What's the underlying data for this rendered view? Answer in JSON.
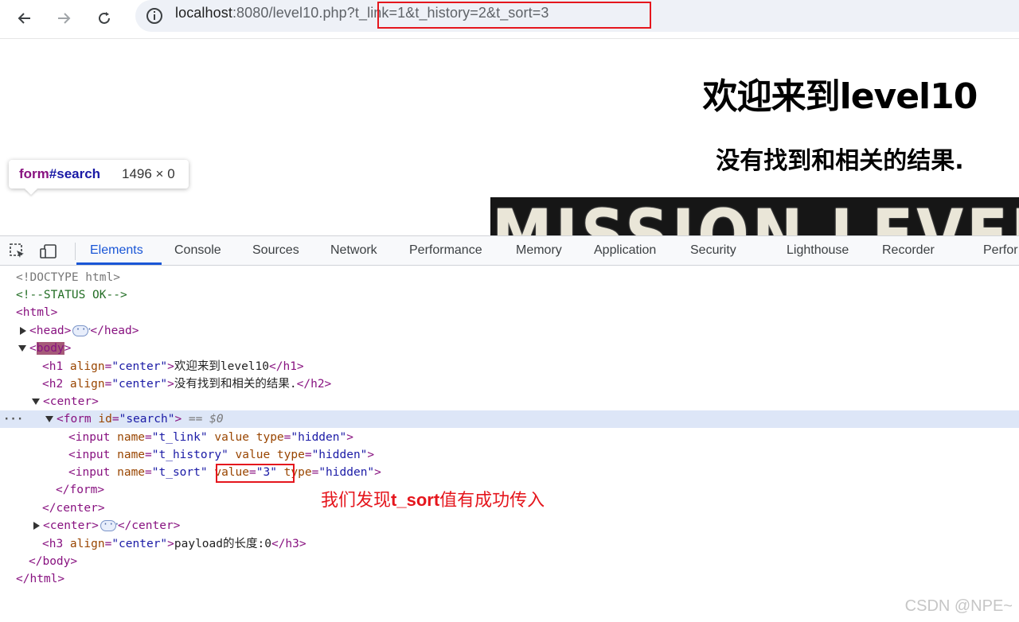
{
  "browser": {
    "url_host": "localhost",
    "url_port_path": ":8080/level10.php",
    "url_query": "?t_link=1&t_history=2&t_sort=3"
  },
  "page": {
    "h1": "欢迎来到level10",
    "h2": "没有找到和相关的结果.",
    "banner_text": "MISSION LEVEL"
  },
  "tooltip": {
    "tag": "form",
    "id": "#search",
    "size": "1496 × 0"
  },
  "devtools": {
    "tabs": [
      "Elements",
      "Console",
      "Sources",
      "Network",
      "Performance",
      "Memory",
      "Application",
      "Security",
      "Lighthouse",
      "Recorder",
      "Perfor"
    ],
    "active_tab": "Elements",
    "selected_marker": "== $0",
    "dots": "···"
  },
  "dom": {
    "doctype": "<!DOCTYPE html>",
    "comment": "<!--STATUS OK-->",
    "html_open": "<html>",
    "head_open": "<head>",
    "head_close": "</head>",
    "body_open_lt": "<",
    "body_name": "body",
    "body_open_gt": ">",
    "h1_open": "<h1 ",
    "h1_attr": "align",
    "h1_val": "\"center\"",
    "h1_text": "欢迎来到level10",
    "h1_close": "</h1>",
    "h2_open": "<h2 ",
    "h2_attr": "align",
    "h2_val": "\"center\"",
    "h2_text": "没有找到和相关的结果.",
    "h2_close": "</h2>",
    "center_open": "<center>",
    "form_open": "<form ",
    "form_attr": "id",
    "form_val": "\"search\"",
    "gt": ">",
    "inputs": [
      {
        "name": "\"t_link\"",
        "value_attr": "value",
        "value_val": "",
        "type_val": "\"hidden\""
      },
      {
        "name": "\"t_history\"",
        "value_attr": "value",
        "value_val": "",
        "type_val": "\"hidden\""
      },
      {
        "name": "\"t_sort\"",
        "value_attr": "value",
        "value_val": "\"3\"",
        "type_val": "\"hidden\""
      }
    ],
    "input_open": "<input ",
    "name_attr": "name",
    "type_attr": "type",
    "eq": "=",
    "form_close": "</form>",
    "center_close": "</center>",
    "h3_open": "<h3 ",
    "h3_attr": "align",
    "h3_val": "\"center\"",
    "h3_text": "payload的长度:0",
    "h3_close": "</h3>",
    "body_close": "</body>",
    "html_close": "</html>"
  },
  "annotation": {
    "prefix": "我们发现",
    "bold": "t_sort",
    "suffix": "值有成功传入"
  },
  "watermark": "CSDN @NPE~",
  "colors": {
    "highlight_red": "#e5161d",
    "active_tab_blue": "#1a56d6",
    "tag_purple": "#881280",
    "attr_brown": "#994500",
    "value_blue": "#1a1aa6"
  }
}
